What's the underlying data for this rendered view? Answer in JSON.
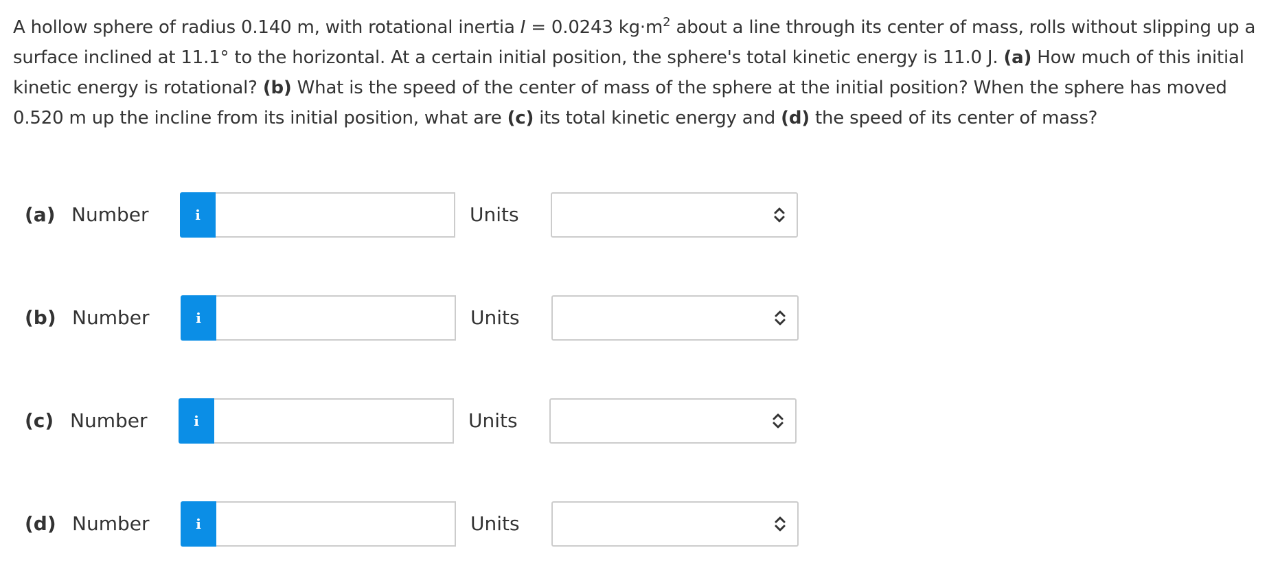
{
  "question": {
    "s1": "A hollow sphere of radius 0.140 m, with rotational inertia ",
    "inertia_symbol": "I",
    "s2": " = 0.0243 kg·m",
    "exponent": "2",
    "s3": " about a line through its center of mass, rolls without slipping up a surface inclined at 11.1° to the horizontal. At a certain initial position, the sphere's total kinetic energy is 11.0 J. ",
    "a_tag": "(a)",
    "a_text": " How much of this initial kinetic energy is rotational? ",
    "b_tag": "(b)",
    "b_text": " What is the speed of the center of mass of the sphere at the initial position? When the sphere has moved 0.520 m up the incline from its initial position, what are ",
    "c_tag": "(c)",
    "c_text": " its total kinetic energy and ",
    "d_tag": "(d)",
    "d_text": " the speed of its center of mass?"
  },
  "answers": [
    {
      "part": "(a)",
      "number_label": "Number",
      "info_label": "i",
      "value": "",
      "units_label": "Units",
      "units_value": ""
    },
    {
      "part": "(b)",
      "number_label": "Number",
      "info_label": "i",
      "value": "",
      "units_label": "Units",
      "units_value": ""
    },
    {
      "part": "(c)",
      "number_label": "Number",
      "info_label": "i",
      "value": "",
      "units_label": "Units",
      "units_value": ""
    },
    {
      "part": "(d)",
      "number_label": "Number",
      "info_label": "i",
      "value": "",
      "units_label": "Units",
      "units_value": ""
    }
  ],
  "colors": {
    "info_button": "#0b8ee6",
    "text": "#333333",
    "border": "#cccccc"
  },
  "icons": {
    "info": "info-icon",
    "select": "chevron-up-down-icon"
  }
}
